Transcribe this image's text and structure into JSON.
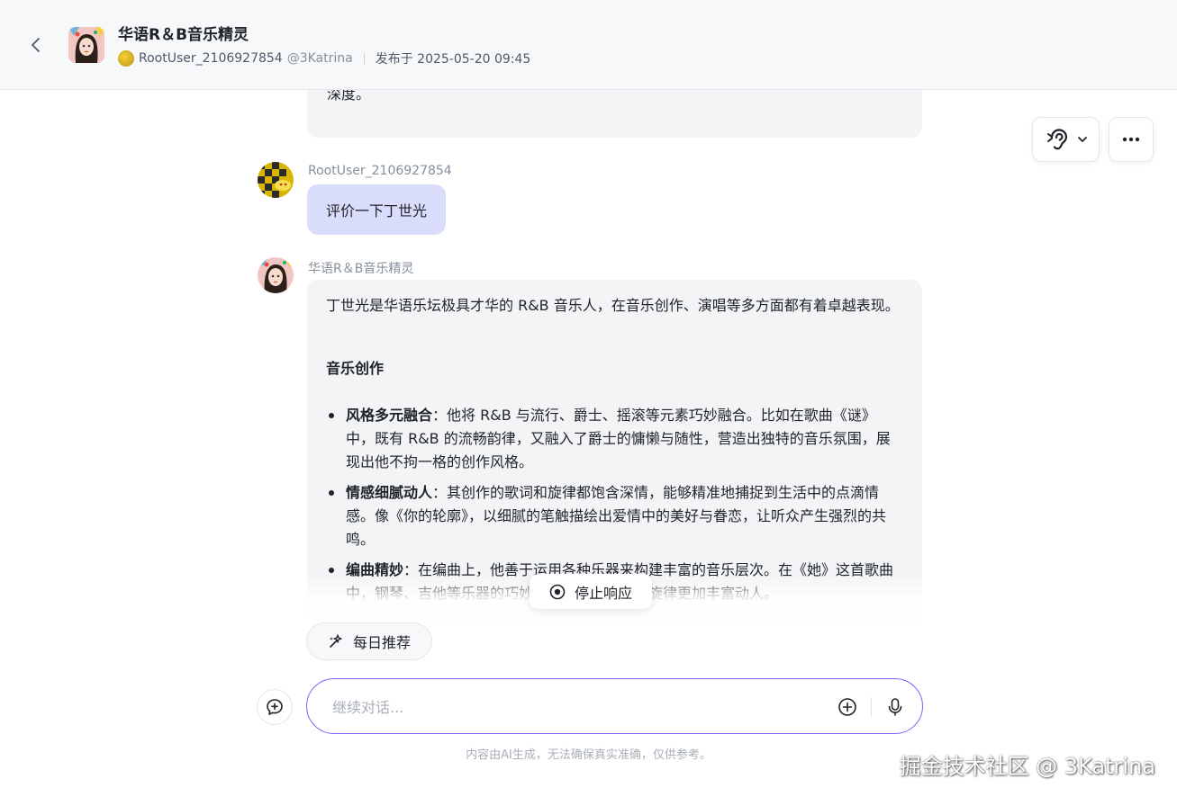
{
  "header": {
    "bot_name": "华语R＆B音乐精灵",
    "author": "RootUser_2106927854",
    "handle": "@3Katrina",
    "published": "发布于 2025-05-20 09:45"
  },
  "messages": {
    "previous_tail": "变化，歌词也颇具深意，探讨了生活中的各种是是非非，展现出陶喆在音乐创作上的才华与深度。",
    "user": {
      "name": "RootUser_2106927854",
      "text": "评价一下丁世光"
    },
    "bot": {
      "name": "华语R＆B音乐精灵",
      "intro": "丁世光是华语乐坛极具才华的 R&B 音乐人，在音乐创作、演唱等多方面都有着卓越表现。",
      "section_title": "音乐创作",
      "items": [
        {
          "title": "风格多元融合",
          "text": "：他将 R&B 与流行、爵士、摇滚等元素巧妙融合。比如在歌曲《谜》中，既有 R&B 的流畅韵律，又融入了爵士的慵懒与随性，营造出独特的音乐氛围，展现出他不拘一格的创作风格。"
        },
        {
          "title": "情感细腻动人",
          "text": "：其创作的歌词和旋律都饱含深情，能够精准地捕捉到生活中的点滴情感。像《你的轮廓》，以细腻的笔触描绘出爱情中的美好与眷恋，让听众产生强烈的共鸣。"
        },
        {
          "title": "编曲精妙",
          "text": "：在编曲上，他善于运用各种乐器来构建丰富的音乐层次。在《她》这首歌曲中，钢琴、吉他等乐器的巧妙搭配，让整首歌的旋律更加丰富动人。"
        }
      ]
    }
  },
  "controls": {
    "stop_label": "停止响应",
    "daily_label": "每日推荐",
    "input_placeholder": "继续对话...",
    "disclaimer": "内容由AI生成，无法确保真实准确，仅供参考。"
  },
  "watermark": "掘金技术社区 @ 3Katrina",
  "colors": {
    "accent": "#7b61ff",
    "user_bubble": "#d9dcfb",
    "bot_bubble": "#f3f4f6",
    "header_bg": "#f7f8fa"
  },
  "icons": {
    "back": "chevron-left-icon",
    "voice": "ear-icon",
    "more": "more-dots-icon",
    "stop": "stop-circle-icon",
    "daily": "sparkle-icon",
    "new_chat": "new-chat-icon",
    "plus": "plus-circle-icon",
    "mic": "microphone-icon"
  }
}
